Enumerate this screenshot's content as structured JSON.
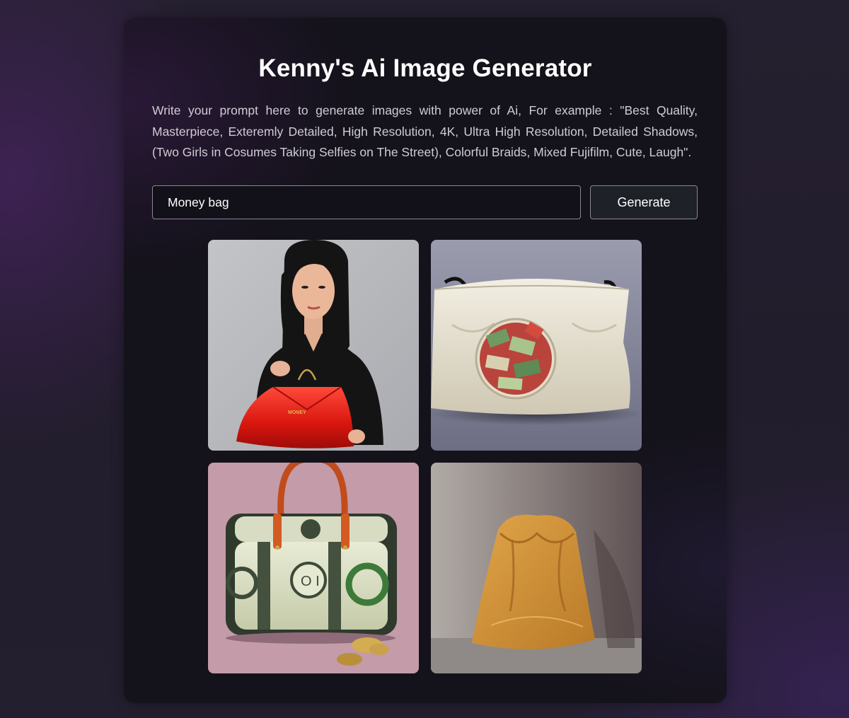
{
  "app": {
    "title": "Kenny's Ai Image Generator",
    "description": "Write your prompt here to generate images with power of Ai, For example : \"Best Quality, Masterpiece, Exteremly Detailed, High Resolution, 4K, Ultra High Resolution, Detailed Shadows, (Two Girls in Cosumes Taking Selfies on The Street), Colorful Braids, Mixed Fujifilm, Cute, Laugh\"."
  },
  "prompt": {
    "value": "Money bag"
  },
  "actions": {
    "generate_label": "Generate"
  },
  "colors": {
    "page_background": "#231f2e",
    "card_background": "#14121a",
    "text_primary": "#ffffff",
    "text_secondary": "#cfccd4",
    "input_border": "#8a8794",
    "button_background": "#1f2129"
  },
  "results": [
    {
      "subject": "woman-holding-red-bag",
      "tag": "MONEY"
    },
    {
      "subject": "cream-bag-with-banknotes"
    },
    {
      "subject": "dollar-bill-duffel-bag-with-coins"
    },
    {
      "subject": "mustard-leather-pouch"
    }
  ]
}
